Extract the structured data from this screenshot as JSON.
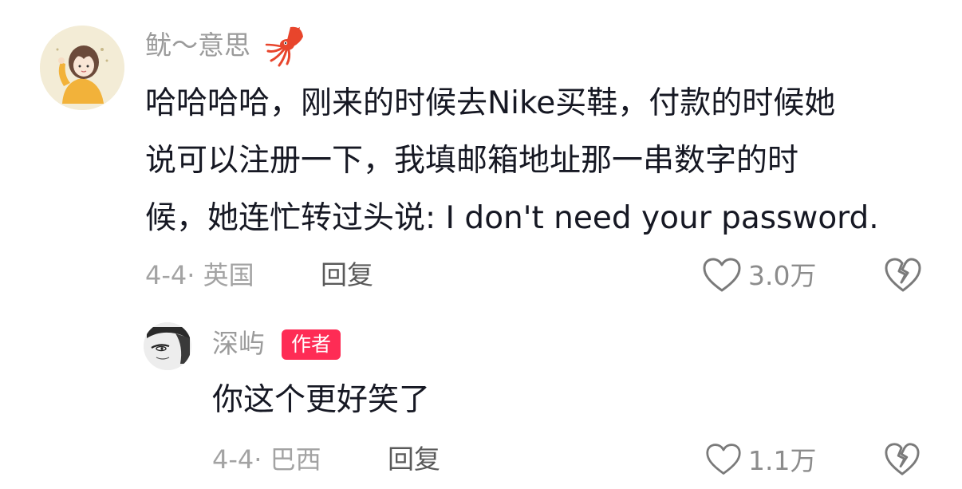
{
  "comment": {
    "username": "鱿～意思",
    "username_emoji_icon": "squid-icon",
    "text_lines": [
      "哈哈哈哈，刚来的时候去Nike买鞋，付款的时候她",
      "说可以注册一下，我填邮箱地址那一串数字的时",
      "候，她连忙转过头说: I don't need your password."
    ],
    "date_location": "4-4· 英国",
    "reply_label": "回复",
    "like_count": "3.0万",
    "like_icon": "heart-outline-icon",
    "dislike_icon": "broken-heart-icon"
  },
  "reply": {
    "username": "深屿",
    "badge": "作者",
    "text": "你这个更好笑了",
    "date_location": "4-4· 巴西",
    "reply_label": "回复",
    "like_count": "1.1万",
    "like_icon": "heart-outline-icon",
    "dislike_icon": "broken-heart-icon"
  },
  "colors": {
    "author_badge": "#fe2c55",
    "username": "#9b9b9b",
    "text": "#161823"
  }
}
